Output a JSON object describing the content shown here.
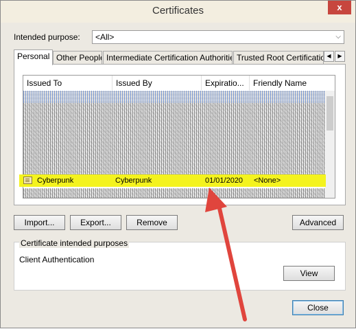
{
  "window": {
    "title": "Certificates",
    "close_label": "x"
  },
  "purpose": {
    "label": "Intended purpose:",
    "value": "<All>"
  },
  "tabs": [
    {
      "label": "Personal",
      "active": true
    },
    {
      "label": "Other People",
      "active": false
    },
    {
      "label": "Intermediate Certification Authorities",
      "active": false
    },
    {
      "label": "Trusted Root Certification",
      "active": false
    }
  ],
  "columns": [
    "Issued To",
    "Issued By",
    "Expiratio...",
    "Friendly Name"
  ],
  "highlighted_row": {
    "issued_to": "Cyberpunk",
    "issued_by": "Cyberpunk",
    "expiration": "01/01/2020",
    "friendly_name": "<None>"
  },
  "buttons": {
    "import": "Import...",
    "export": "Export...",
    "remove": "Remove",
    "advanced": "Advanced",
    "view": "View",
    "close": "Close"
  },
  "purposes_group": {
    "title": "Certificate intended purposes",
    "value": "Client Authentication"
  },
  "colors": {
    "highlight": "#f4f31e",
    "annotation_arrow": "#e0453d"
  }
}
